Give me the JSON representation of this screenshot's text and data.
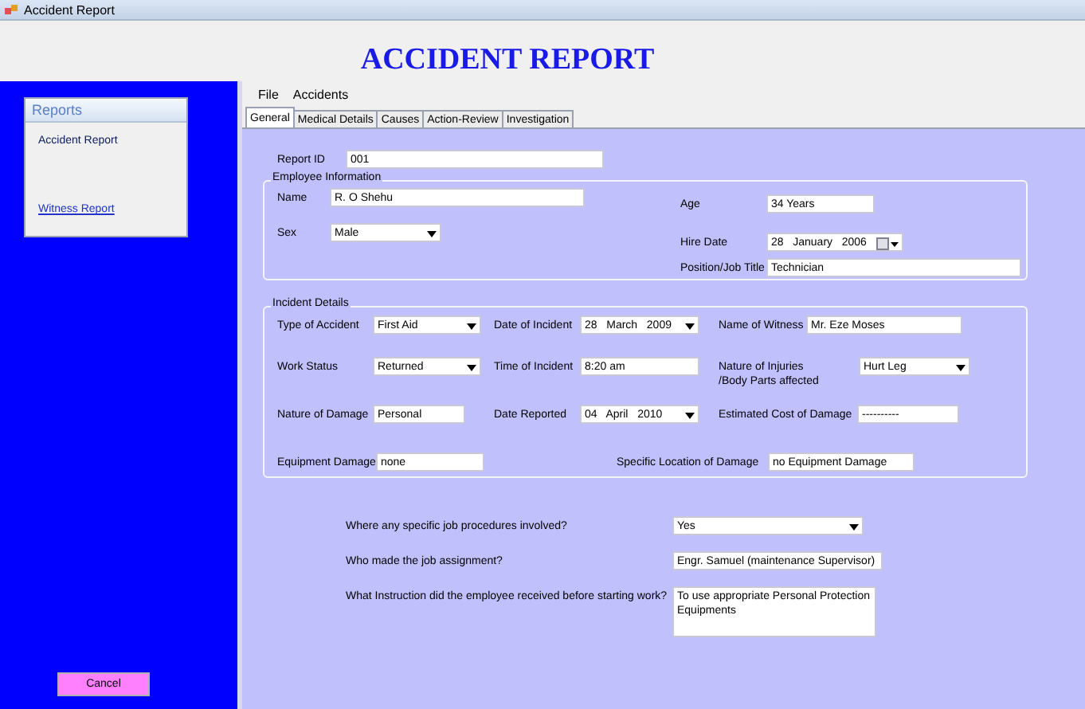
{
  "window": {
    "title": "Accident Report"
  },
  "header": {
    "title": "ACCIDENT REPORT"
  },
  "sidebar": {
    "title": "Reports",
    "items": [
      {
        "label": "Accident Report",
        "kind": "text"
      },
      {
        "label": "Witness Report",
        "kind": "link"
      }
    ],
    "cancel": "Cancel"
  },
  "menu": [
    "File",
    "Accidents"
  ],
  "tabs": [
    {
      "label": "General",
      "selected": true
    },
    {
      "label": "Medical Details",
      "selected": false
    },
    {
      "label": "Causes",
      "selected": false
    },
    {
      "label": "Action-Review",
      "selected": false
    },
    {
      "label": "Investigation",
      "selected": false
    }
  ],
  "report_id": {
    "label": "Report ID",
    "value": "001",
    "kind": "text"
  },
  "employee_information": {
    "title": "Employee Information",
    "left": [
      {
        "label": "Name",
        "value": "R. O Shehu",
        "kind": "text"
      },
      {
        "label": "Sex",
        "value": "Male",
        "kind": "select"
      }
    ],
    "right": [
      {
        "label": "Age",
        "value": "34 Years",
        "kind": "text"
      },
      {
        "label": "Hire Date",
        "value": "28   January   2006",
        "kind": "calendar"
      },
      {
        "label": "Position/Job Title",
        "value": "Technician",
        "kind": "text"
      }
    ]
  },
  "incident_details": {
    "title": "Incident Details",
    "rows": [
      [
        {
          "label": "Type of Accident",
          "value": "First Aid",
          "kind": "select"
        },
        {
          "label": "Date of Incident",
          "value": "28   March   2009",
          "kind": "select"
        },
        {
          "label": "Name of Witness",
          "value": "Mr. Eze Moses",
          "kind": "text"
        }
      ],
      [
        {
          "label": "Work Status",
          "value": "Returned",
          "kind": "select"
        },
        {
          "label": "Time of Incident",
          "value": "8:20 am",
          "kind": "text"
        },
        {
          "label": "Nature of Injuries /Body Parts affected",
          "value": "Hurt Leg",
          "kind": "select"
        }
      ],
      [
        {
          "label": "Nature of Damage",
          "value": "Personal",
          "kind": "text"
        },
        {
          "label": "Date Reported",
          "value": "04   April   2010",
          "kind": "select"
        },
        {
          "label": "Estimated Cost of Damage",
          "value": "----------",
          "kind": "text"
        }
      ],
      [
        {
          "label": "Equipment Damage",
          "value": "none",
          "kind": "text"
        },
        {
          "label": "Specific Location of Damage",
          "value": "no Equipment Damage",
          "kind": "text"
        }
      ]
    ]
  },
  "questions": [
    {
      "label": "Where any specific job procedures involved?",
      "value": "Yes",
      "kind": "select"
    },
    {
      "label": "Who made the job assignment?",
      "value": "Engr. Samuel (maintenance Supervisor)",
      "kind": "text"
    },
    {
      "label": "What Instruction did the employee received before starting work?",
      "value": "To use appropriate Personal Protection Equipments",
      "kind": "multiline"
    }
  ]
}
